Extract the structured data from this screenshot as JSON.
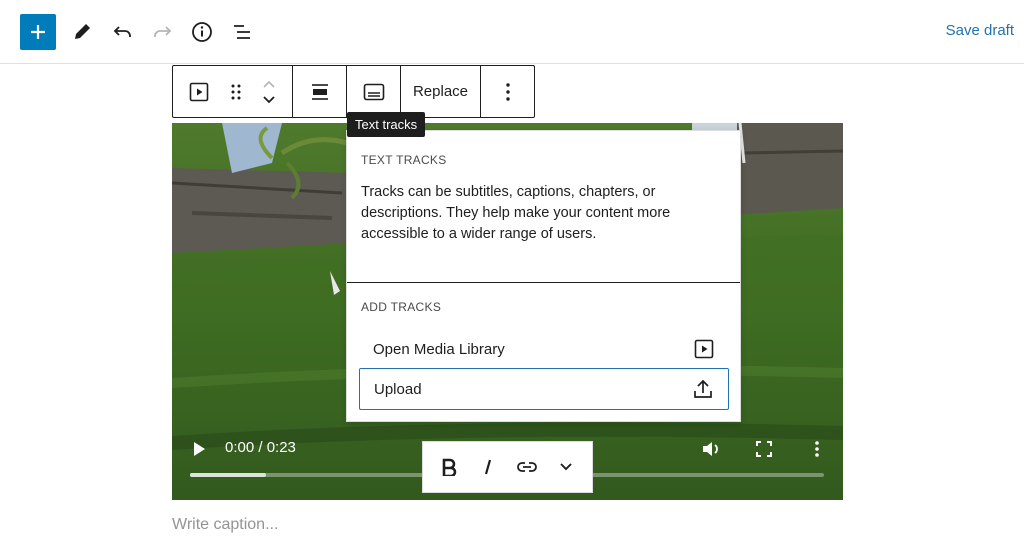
{
  "header": {
    "save_draft_label": "Save draft"
  },
  "block_toolbar": {
    "replace_label": "Replace"
  },
  "tooltip": {
    "text": "Text tracks"
  },
  "popover": {
    "text_tracks_title": "TEXT TRACKS",
    "description": "Tracks can be subtitles, captions, chapters, or descriptions. They help make your content more accessible to a wider range of users.",
    "add_tracks_title": "ADD TRACKS",
    "items": [
      {
        "label": "Open Media Library",
        "icon": "media-library-icon"
      },
      {
        "label": "Upload",
        "icon": "upload-icon"
      }
    ]
  },
  "video": {
    "time": "0:00 / 0:23",
    "progress": 0.12
  },
  "caption": {
    "placeholder": "Write caption..."
  },
  "colors": {
    "accent": "#007cba",
    "link": "#2271b1",
    "dark": "#1e1e1e"
  }
}
